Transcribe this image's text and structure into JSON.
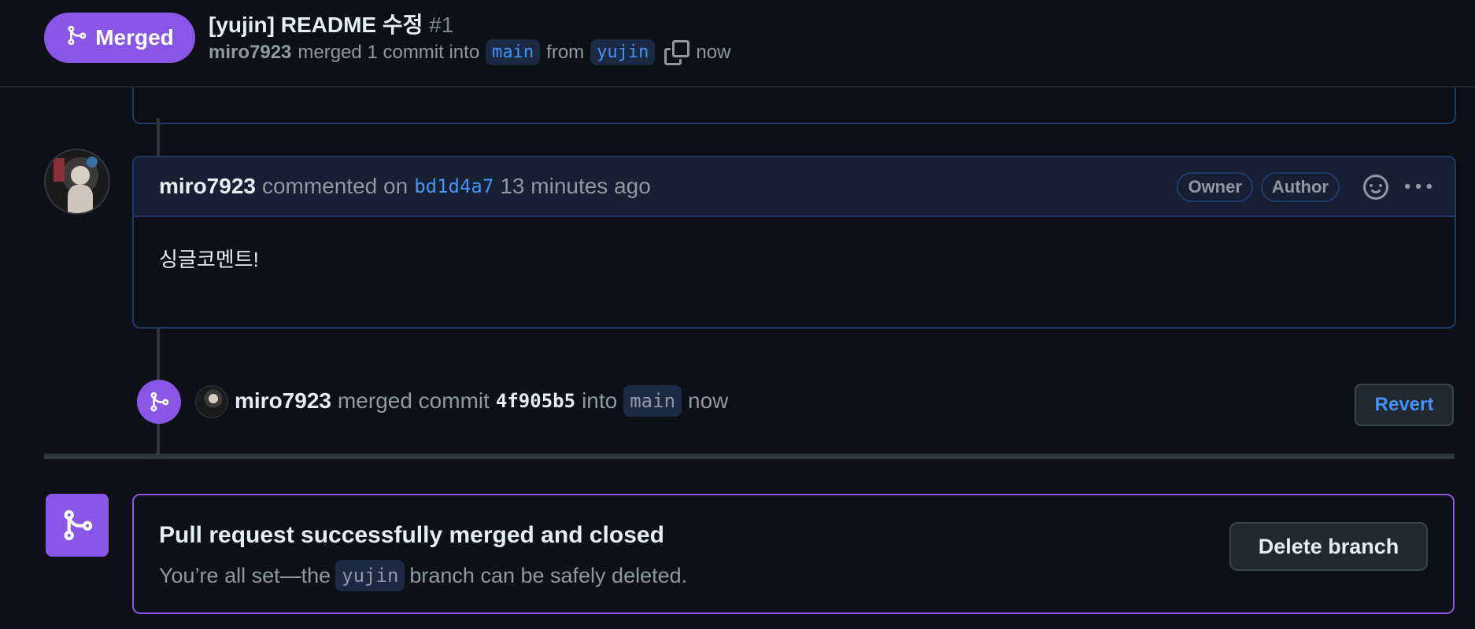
{
  "header": {
    "state_label": "Merged",
    "title": "[yujin] README 수정",
    "number": "#1",
    "meta": {
      "user": "miro7923",
      "action": "merged 1 commit into",
      "base_branch": "main",
      "from_text": "from",
      "head_branch": "yujin",
      "time": "now"
    }
  },
  "comment": {
    "author": "miro7923",
    "action": "commented on",
    "commit_sha": "bd1d4a7",
    "time": "13 minutes ago",
    "labels": [
      "Owner",
      "Author"
    ],
    "body": "싱글코멘트!"
  },
  "merge_event": {
    "user": "miro7923",
    "action": "merged commit",
    "commit": "4f905b5",
    "into_text": "into",
    "branch": "main",
    "time": "now",
    "revert_label": "Revert"
  },
  "merged_box": {
    "title": "Pull request successfully merged and closed",
    "desc_before": "You’re all set—the",
    "branch": "yujin",
    "desc_after": "branch can be safely deleted.",
    "delete_label": "Delete branch"
  },
  "colors": {
    "background": "#0d1117",
    "merged_purple": "#8957e5",
    "link_blue": "#4493f8",
    "muted_text": "#9198a1"
  },
  "icons": [
    "git-merge-icon",
    "copy-icon",
    "smiley-icon",
    "kebab-icon"
  ]
}
